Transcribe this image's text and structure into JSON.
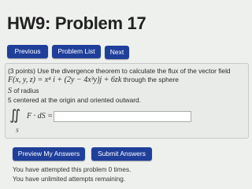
{
  "page": {
    "title": "HW9: Problem 17"
  },
  "nav": {
    "previous": "Previous",
    "problem_list": "Problem List",
    "next": "Next"
  },
  "problem": {
    "points": "(3 points)",
    "intro": "Use the divergence theorem to calculate the flux of the vector field",
    "field_lhs": "F(x, y, z) = ",
    "field_rhs": "x⁴ i + (2y − 4x³y)j + 6zk",
    "field_tail": " through the sphere",
    "sphere_symbol": "S",
    "radius_label": " of radius",
    "radius_value": "5",
    "center_text": " centered at the origin and oriented outward.",
    "integral_symbol": "∬",
    "integral_domain": "S",
    "integrand": "F · dS =",
    "answer_value": ""
  },
  "actions": {
    "preview": "Preview My Answers",
    "submit": "Submit Answers"
  },
  "status": {
    "attempts": "You have attempted this problem 0 times.",
    "remaining": "You have unlimited attempts remaining."
  },
  "colors": {
    "button": "#1f3f9a",
    "background": "#eef0ee"
  }
}
